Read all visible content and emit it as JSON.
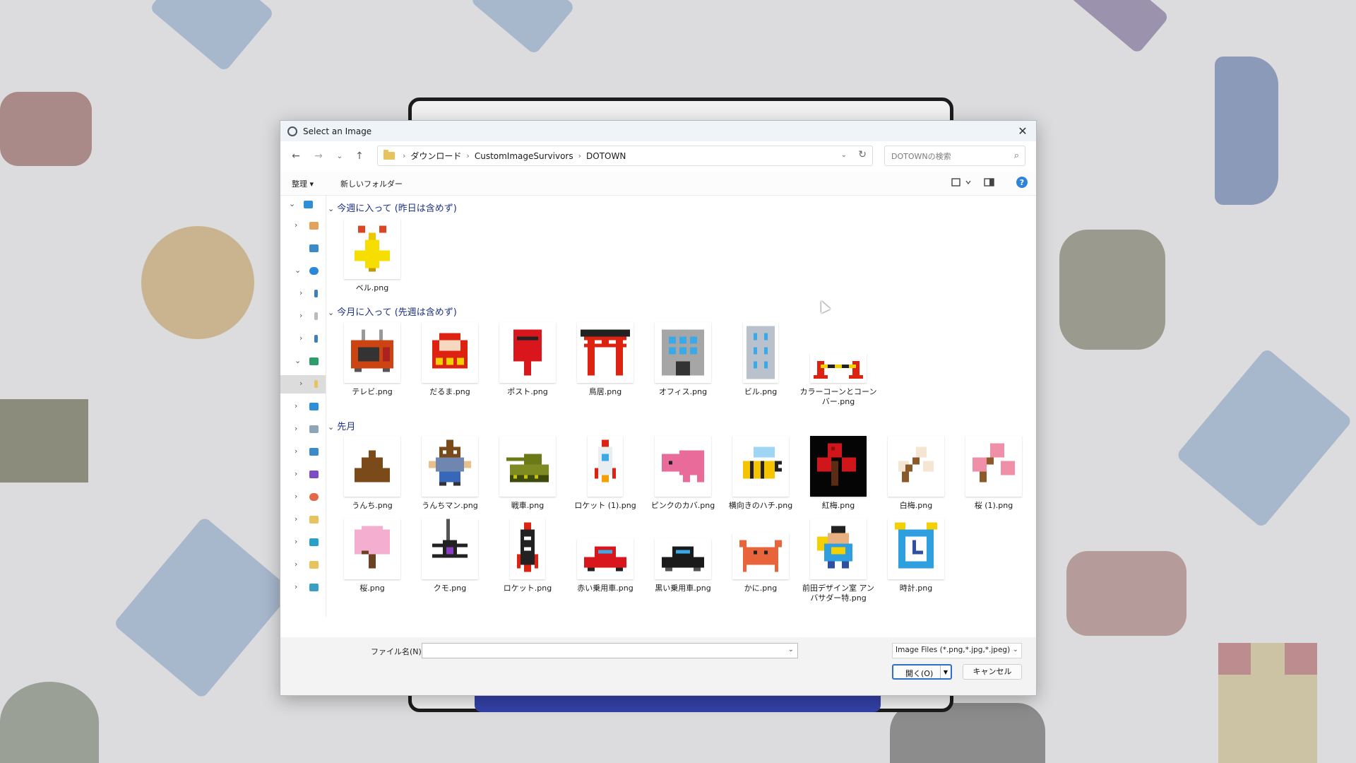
{
  "dialog": {
    "title": "Select an Image",
    "close_icon": "close-icon",
    "address": {
      "crumbs": [
        "ダウンロード",
        "CustomImageSurvivors",
        "DOTOWN"
      ]
    },
    "search_placeholder": "DOTOWNの検索",
    "toolbar": {
      "organize": "整理 ▾",
      "new_folder": "新しいフォルダー",
      "help": "?"
    },
    "groups": [
      {
        "header": "今週に入って (昨日は含めず)",
        "files": [
          {
            "name": "ベル.png",
            "icon": "bell"
          }
        ]
      },
      {
        "header": "今月に入って (先週は含めず)",
        "files": [
          {
            "name": "テレビ.png",
            "icon": "tv"
          },
          {
            "name": "だるま.png",
            "icon": "daruma"
          },
          {
            "name": "ポスト.png",
            "icon": "postbox"
          },
          {
            "name": "鳥居.png",
            "icon": "torii"
          },
          {
            "name": "オフィス.png",
            "icon": "office"
          },
          {
            "name": "ビル.png",
            "icon": "building"
          },
          {
            "name": "カラーコーンとコーンバー.png",
            "icon": "cone-bar"
          }
        ]
      },
      {
        "header": "先月",
        "files": [
          {
            "name": "うんち.png",
            "icon": "poop"
          },
          {
            "name": "うんちマン.png",
            "icon": "poop-man"
          },
          {
            "name": "戦車.png",
            "icon": "tank"
          },
          {
            "name": "ロケット (1).png",
            "icon": "rocket-white"
          },
          {
            "name": "ピンクのカバ.png",
            "icon": "pink-hippo"
          },
          {
            "name": "横向きのハチ.png",
            "icon": "bee"
          },
          {
            "name": "紅梅.png",
            "icon": "red-plum"
          },
          {
            "name": "白梅.png",
            "icon": "white-plum"
          },
          {
            "name": "桜 (1).png",
            "icon": "sakura-branch"
          },
          {
            "name": "桜.png",
            "icon": "sakura-tree"
          },
          {
            "name": "クモ.png",
            "icon": "spider"
          },
          {
            "name": "ロケット.png",
            "icon": "rocket-black"
          },
          {
            "name": "赤い乗用車.png",
            "icon": "red-car"
          },
          {
            "name": "黒い乗用車.png",
            "icon": "black-car"
          },
          {
            "name": "かに.png",
            "icon": "crab"
          },
          {
            "name": "前田デザイン室 アンバサダー特.png",
            "icon": "ambassador"
          },
          {
            "name": "時計.png",
            "icon": "clock"
          }
        ]
      }
    ],
    "footer": {
      "filename_label": "ファイル名(N):",
      "filename_value": "",
      "filter": "Image Files (*.png,*.jpg,*.jpeg)",
      "open": "開く(O)",
      "cancel": "キャンセル"
    }
  }
}
